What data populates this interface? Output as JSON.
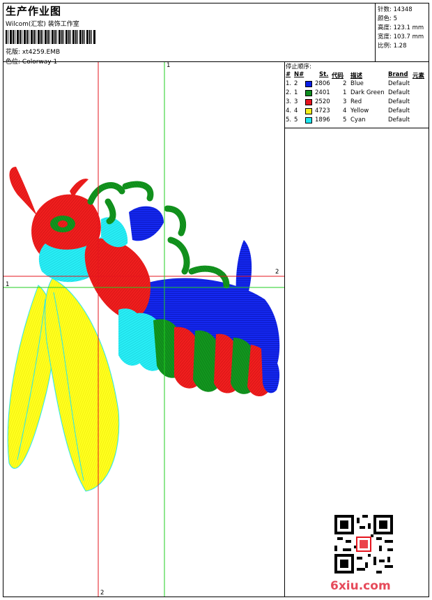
{
  "header": {
    "title": "生产作业图",
    "company": "Wilcom(汇宏) 装饰工作室",
    "design_label": "花版:",
    "design_name": "xt4259.EMB",
    "colorway_label": "色位:",
    "colorway_name": "Colorway 1"
  },
  "stats": {
    "stitches": "针数: 14348",
    "colors": "颜色: 5",
    "height": "高度: 123.1 mm",
    "width": "宽度: 103.7 mm",
    "scale": "比例: 1.28"
  },
  "stops": {
    "title": "停止顺序:",
    "headers": [
      "#",
      "N#",
      "St.",
      "代码",
      "描述",
      "Brand",
      "元素"
    ],
    "rows": [
      {
        "idx": "1.",
        "n": "2",
        "swatch": "#0a1ee6",
        "st": "2806",
        "code": "2",
        "desc": "Blue",
        "brand": "Default"
      },
      {
        "idx": "2.",
        "n": "1",
        "swatch": "#0e8c1e",
        "st": "2401",
        "code": "1",
        "desc": "Dark Green",
        "brand": "Default"
      },
      {
        "idx": "3.",
        "n": "3",
        "swatch": "#e6141e",
        "st": "2520",
        "code": "3",
        "desc": "Red",
        "brand": "Default"
      },
      {
        "idx": "4.",
        "n": "4",
        "swatch": "#f5f01e",
        "st": "4723",
        "code": "4",
        "desc": "Yellow",
        "brand": "Default"
      },
      {
        "idx": "5.",
        "n": "5",
        "swatch": "#1ee6f0",
        "st": "1896",
        "code": "5",
        "desc": "Cyan",
        "brand": "Default"
      }
    ]
  },
  "guides": {
    "green_v_label": "1",
    "green_h_label": "1",
    "red_h_label": "2",
    "red_v_label": "2"
  },
  "watermark": "6xiu.com",
  "colors": {
    "red_guide": "#e6141e",
    "green_guide": "#22cc22"
  }
}
